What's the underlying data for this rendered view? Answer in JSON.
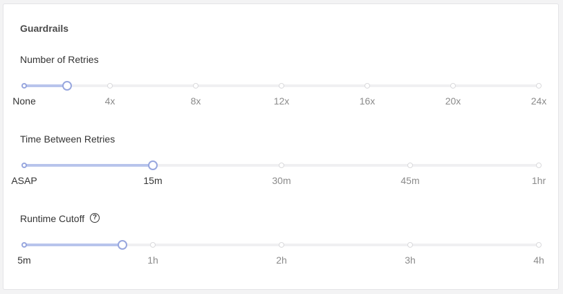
{
  "guardrails": {
    "title": "Guardrails",
    "sliders": [
      {
        "label": "Number of Retries",
        "has_help": false,
        "ticks": [
          "None",
          "4x",
          "8x",
          "12x",
          "16x",
          "20x",
          "24x"
        ],
        "value_fraction": 0.0833,
        "active_tick_index": 0
      },
      {
        "label": "Time Between Retries",
        "has_help": false,
        "ticks": [
          "ASAP",
          "15m",
          "30m",
          "45m",
          "1hr"
        ],
        "value_fraction": 0.25,
        "active_tick_index": 1
      },
      {
        "label": "Runtime Cutoff",
        "has_help": true,
        "ticks": [
          "5m",
          "1h",
          "2h",
          "3h",
          "4h"
        ],
        "value_fraction": 0.1915,
        "active_tick_index": 0
      }
    ]
  },
  "colors": {
    "fill": "#b8c4ec",
    "handle_border": "#97a6de",
    "track": "#f0f0f2"
  },
  "icons": {
    "help": "question-circle-icon",
    "help_glyph": "?"
  }
}
